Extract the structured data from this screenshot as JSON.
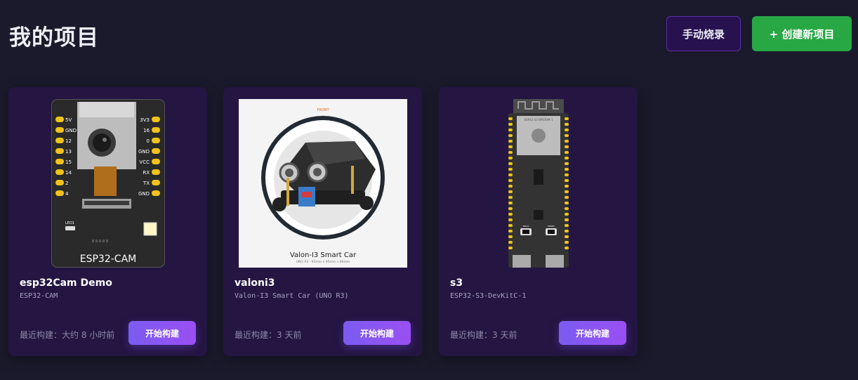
{
  "header": {
    "title": "我的项目",
    "flash_button": "手动烧录",
    "create_button": "+ 创建新项目"
  },
  "colors": {
    "background": "#1a1a2c",
    "card": "#241542",
    "create_button": "#28a745",
    "build_button": "#8b55f0"
  },
  "projects": [
    {
      "name": "esp32Cam Demo",
      "board": "ESP32-CAM",
      "last_build": "最近构建：大约 8 小时前",
      "build_button": "开始构建",
      "image": {
        "caption": "ESP32-CAM",
        "pins_left": [
          "5V",
          "GND",
          "12",
          "13",
          "15",
          "14",
          "2",
          "4"
        ],
        "pins_right": [
          "3V3",
          "16",
          "0",
          "GND",
          "VCC",
          "RX",
          "TX",
          "GND"
        ],
        "led_label": "LED1"
      }
    },
    {
      "name": "valoni3",
      "board": "Valon-I3 Smart Car (UNO R3)",
      "last_build": "最近构建：3 天前",
      "build_button": "开始构建",
      "image": {
        "front_label": "FRONT",
        "caption": "Valon-I3 Smart Car",
        "sub_caption": "UNO R3 · 95mm x 95mm x 80mm"
      }
    },
    {
      "name": "s3",
      "board": "ESP32-S3-DevKitC-1",
      "last_build": "最近构建：3 天前",
      "build_button": "开始构建",
      "image": {
        "module_label": "ESP32-S3-WROOM-1",
        "boot_label": "BOOT",
        "reset_label": "RESET"
      }
    }
  ]
}
